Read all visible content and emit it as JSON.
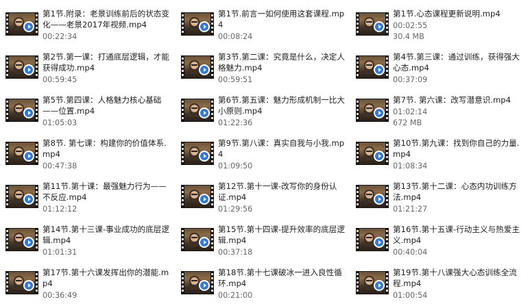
{
  "files": [
    {
      "title": "第1节.附录：老景训练前后的状态变化——老景2017年视频.mp4",
      "meta": "00:22:34"
    },
    {
      "title": "第1节.前言一如何使用这套课程.mp4",
      "meta": "00:08:24"
    },
    {
      "title": "第1节.心态课程更新说明.mp4",
      "meta": "00:02:55",
      "meta2": "30.4 MB"
    },
    {
      "title": "第2节.第一课：打通底层逻辑，才能获得成功.mp4",
      "meta": "00:59:45"
    },
    {
      "title": "第3节.第二课：究竟是什么，决定人格魅力.mp4",
      "meta": "00:59:51"
    },
    {
      "title": "第4节.第三课：通过训练，获得强大心态.mp4",
      "meta": "00:37:09"
    },
    {
      "title": "第5节.第四课：人格魅力核心基础——位置.mp4",
      "meta": "01:05:03"
    },
    {
      "title": "第6节.第五课：魅力形成机制一比大小原则.mp4",
      "meta": "01:22:36"
    },
    {
      "title": "第7节. 第六课：改写潜意识.mp4",
      "meta": "01:02:14",
      "meta2": "672 MB"
    },
    {
      "title": "第8节. 第七课：构建你的价值体系.mp4",
      "meta": "00:47:38"
    },
    {
      "title": "第9节.第八课：真实自我与小我.mp4",
      "meta": "01:09:50"
    },
    {
      "title": "第10节.第九课：找到你自己的力量.mp4",
      "meta": "01:08:34"
    },
    {
      "title": "第11节.第十课：最强魅力行为——不反应.mp4",
      "meta": "01:12:12"
    },
    {
      "title": "第12节.第十一课-改写你的身份认证.mp4",
      "meta": "01:29:56"
    },
    {
      "title": "第13节.第十二课：心态内功训练方法.mp4",
      "meta": "01:21:27"
    },
    {
      "title": "第14节.第十三课-事业成功的底层逻辑.mp4",
      "meta": "01:01:31"
    },
    {
      "title": "第15节.第十四课-提升效率的底层逻辑.mp4",
      "meta": "00:37:18"
    },
    {
      "title": "第16节.第十五课-行动主义与热爱主义.mp4",
      "meta": "00:40:04"
    },
    {
      "title": "第17节.第十六课发挥出你的潜能.mp4",
      "meta": "00:36:49"
    },
    {
      "title": "第18节.第十七课破冰一进入良性循环.mp4",
      "meta": "00:21:00"
    },
    {
      "title": "第19节.第十八课强大心态训练全流程.mp4",
      "meta": "01:00:54"
    }
  ]
}
